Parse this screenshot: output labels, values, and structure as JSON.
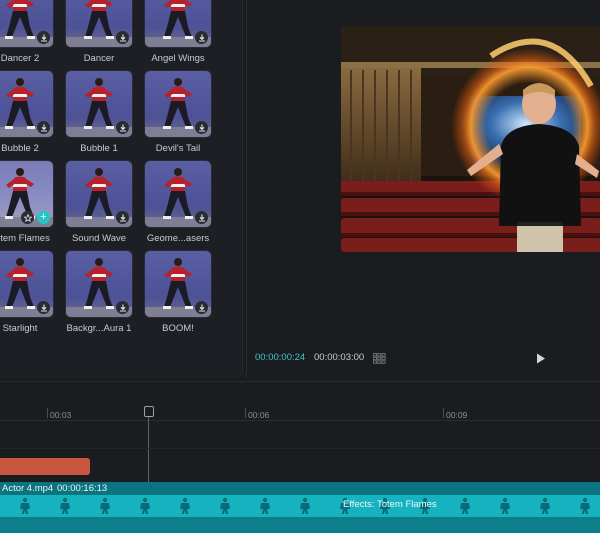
{
  "effects": {
    "items": [
      {
        "label": "Dancer 2",
        "selected": false
      },
      {
        "label": "Dancer",
        "selected": false
      },
      {
        "label": "Angel Wings",
        "selected": false
      },
      {
        "label": "Bubble 2",
        "selected": false
      },
      {
        "label": "Bubble 1",
        "selected": false
      },
      {
        "label": "Devil's Tail",
        "selected": false
      },
      {
        "label": "Totem Flames",
        "selected": true
      },
      {
        "label": "Sound Wave",
        "selected": false
      },
      {
        "label": "Geome...asers",
        "selected": false
      },
      {
        "label": "Starlight",
        "selected": false
      },
      {
        "label": "Backgr...Aura 1",
        "selected": false
      },
      {
        "label": "BOOM!",
        "selected": false
      }
    ]
  },
  "player": {
    "current_time": "00:00:00:24",
    "total_time": "00:00:03:00"
  },
  "timeline": {
    "ruler_labels": [
      "00:03",
      "00:06",
      "00:09"
    ],
    "clip_name": "Actor 4.mp4",
    "clip_duration": "00:00:16:13",
    "effect_label": "Effects: Totem Flames"
  },
  "colors": {
    "accent": "#3fc4cf",
    "clip": "#17b2bf",
    "orange_clip": "#c9573f"
  }
}
